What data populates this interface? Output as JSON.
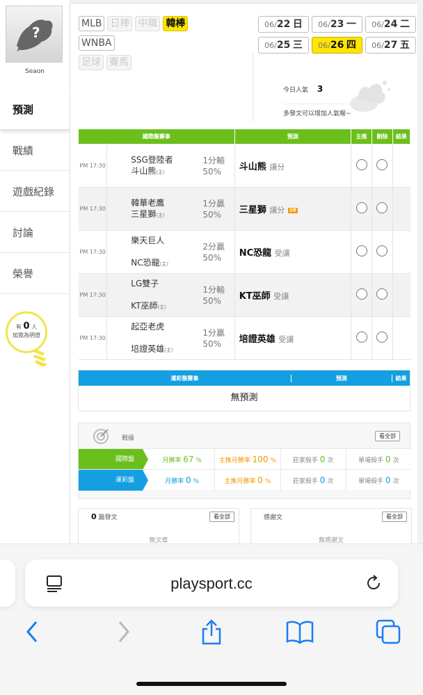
{
  "sidebar": {
    "user_name": "Seaon",
    "nav": [
      {
        "label": "預測",
        "active": true
      },
      {
        "label": "戰績",
        "active": false
      },
      {
        "label": "遊戲紀錄",
        "active": false
      },
      {
        "label": "討論",
        "active": false
      },
      {
        "label": "榮譽",
        "active": false
      }
    ],
    "fans": {
      "prefix": "有",
      "count": "0",
      "unit": "人",
      "caption": "加我為明燈"
    }
  },
  "leagues": {
    "row1": [
      {
        "label": "MLB",
        "state": "normal"
      },
      {
        "label": "日棒",
        "state": "disabled"
      },
      {
        "label": "中職",
        "state": "disabled"
      },
      {
        "label": "韓棒",
        "state": "selected"
      }
    ],
    "row2": [
      {
        "label": "WNBA",
        "state": "normal"
      }
    ],
    "row3": [
      {
        "label": "足球",
        "state": "disabled"
      },
      {
        "label": "賽馬",
        "state": "disabled"
      }
    ]
  },
  "dates": [
    {
      "md": "06/",
      "day": "22",
      "wd": "日",
      "selected": false
    },
    {
      "md": "06/",
      "day": "23",
      "wd": "一",
      "selected": false
    },
    {
      "md": "06/",
      "day": "24",
      "wd": "二",
      "selected": false
    },
    {
      "md": "06/",
      "day": "25",
      "wd": "三",
      "selected": false
    },
    {
      "md": "06/",
      "day": "26",
      "wd": "四",
      "selected": true
    },
    {
      "md": "06/",
      "day": "27",
      "wd": "五",
      "selected": false
    }
  ],
  "popularity": {
    "label": "今日人氣",
    "value": "3",
    "hint": "多發文可以增加人氣喔~"
  },
  "intl_table": {
    "headers": [
      "國際盤賽事",
      "預測",
      "主推",
      "刪除",
      "結果"
    ],
    "rows": [
      {
        "time": "PM 17:30",
        "away": "SSG登陸者",
        "home": "斗山熊",
        "home_mark": "(主)",
        "line1": "1分輸",
        "line2": "50%",
        "pick": "斗山熊",
        "pick_type": "讓分",
        "tag": "",
        "home_on_top": false
      },
      {
        "time": "PM 17:30",
        "away": "韓華老鷹",
        "home": "三星獅",
        "home_mark": "(主)",
        "line1": "1分贏",
        "line2": "50%",
        "pick": "三星獅",
        "pick_type": "讓分",
        "tag": "主推",
        "home_on_top": false
      },
      {
        "time": "PM 17:30",
        "away": "樂天巨人",
        "home": "NC恐龍",
        "home_mark": "(主)",
        "line1": "2分贏",
        "line2": "50%",
        "pick": "NC恐龍",
        "pick_type": "受讓",
        "tag": "",
        "home_on_top": true
      },
      {
        "time": "PM 17:30",
        "away": "LG雙子",
        "home": "KT巫師",
        "home_mark": "(主)",
        "line1": "1分輸",
        "line2": "50%",
        "pick": "KT巫師",
        "pick_type": "受讓",
        "tag": "",
        "home_on_top": true
      },
      {
        "time": "PM 17:30",
        "away": "起亞老虎",
        "home": "培證英雄",
        "home_mark": "(主)",
        "line1": "1分贏",
        "line2": "50%",
        "pick": "培證英雄",
        "pick_type": "受讓",
        "tag": "",
        "home_on_top": true
      }
    ]
  },
  "lottery_table": {
    "headers": [
      "運彩盤賽事",
      "預測",
      "結果"
    ],
    "empty": "無預測"
  },
  "record": {
    "title": "戰績",
    "view_all": "看全部",
    "rows": [
      {
        "label": "國際盤",
        "color": "#6bbf1c",
        "month_label": "月勝率",
        "month": "67",
        "month_unit": "%",
        "home_label": "主推月勝率",
        "home": "100",
        "home_unit": "%",
        "banker_label": "莊家殺手",
        "banker": "0",
        "banker_unit": "次",
        "single_label": "單場殺手",
        "single": "0",
        "single_unit": "次"
      },
      {
        "label": "運彩盤",
        "color": "#139fe2",
        "month_label": "月勝率",
        "month": "0",
        "month_unit": "%",
        "home_label": "主推月勝率",
        "home": "0",
        "home_unit": "%",
        "banker_label": "莊家殺手",
        "banker": "0",
        "banker_unit": "次",
        "single_label": "單場殺手",
        "single": "0",
        "single_unit": "次"
      }
    ]
  },
  "posts": {
    "count": "0",
    "label": "篇發文",
    "view_all": "看全部",
    "empty": "無文章"
  },
  "thanks": {
    "label": "感謝文",
    "view_all": "看全部",
    "empty": "無感謝文"
  },
  "browser": {
    "url": "playsport.cc"
  },
  "icons": {
    "reader": "reader-mode-icon",
    "reload": "reload-icon",
    "back": "back-icon",
    "forward": "forward-icon",
    "share": "share-icon",
    "bookmarks": "bookmarks-icon",
    "tabs": "tabs-icon"
  }
}
